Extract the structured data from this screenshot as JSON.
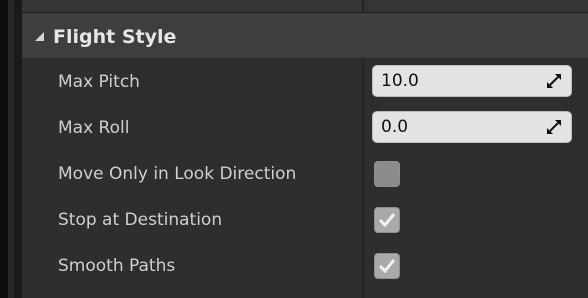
{
  "category": {
    "title": "Flight Style"
  },
  "rows": [
    {
      "label": "Max Pitch",
      "value": "10.0"
    },
    {
      "label": "Max Roll",
      "value": "0.0"
    },
    {
      "label": "Move Only in Look Direction",
      "checked": false
    },
    {
      "label": "Stop at Destination",
      "checked": true
    },
    {
      "label": "Smooth Paths",
      "checked": true
    }
  ],
  "icons": {
    "collapse": "triangle-down-icon",
    "spin": "spin-arrows-icon",
    "check": "checkmark-icon"
  },
  "colors": {
    "panel": "#2e2e2e",
    "category": "#3e3e3e",
    "input": "#e3e3e3",
    "checkbox": "#a9a9a9"
  }
}
